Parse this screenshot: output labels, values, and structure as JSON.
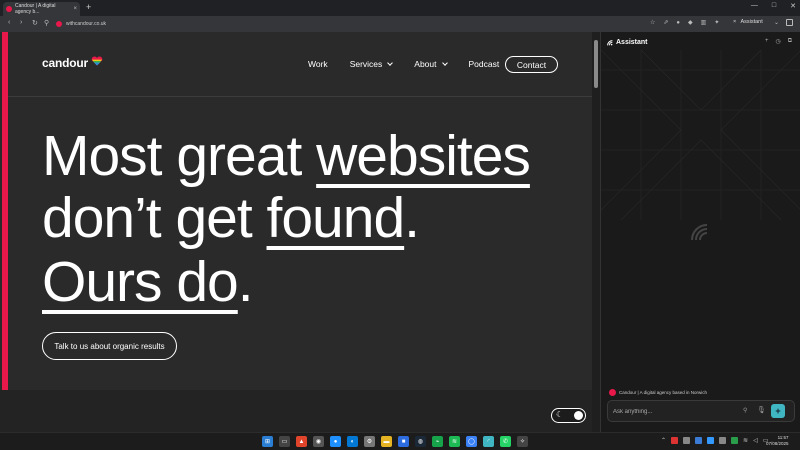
{
  "browser": {
    "tab_title": "Candour | A digital agency b...",
    "tab_close": "×",
    "new_tab": "+",
    "url": "withcandour.co.uk",
    "assistant_tab_label": "Assistant",
    "assistant_tab_close": "×"
  },
  "site": {
    "logo_text": "candour",
    "nav": {
      "work": "Work",
      "services": "Services",
      "about": "About",
      "podcast": "Podcast",
      "contact": "Contact"
    },
    "hero": {
      "line1_plain": "Most great ",
      "line1_link": "websites",
      "line2_plain": "don’t get ",
      "line2_link": "found",
      "line2_end": ".",
      "line3_link": "Ours do",
      "line3_end": "."
    },
    "cta_label": "Talk to us about organic results",
    "accent_color": "#e8184a"
  },
  "assistant": {
    "title": "Assistant",
    "context_label": "Candour | A digital agency based in Norwich",
    "input_placeholder": "Ask anything...",
    "send_color": "#3fb6c2"
  },
  "taskbar": {
    "time": "11:57",
    "date": "07/08/2025"
  }
}
